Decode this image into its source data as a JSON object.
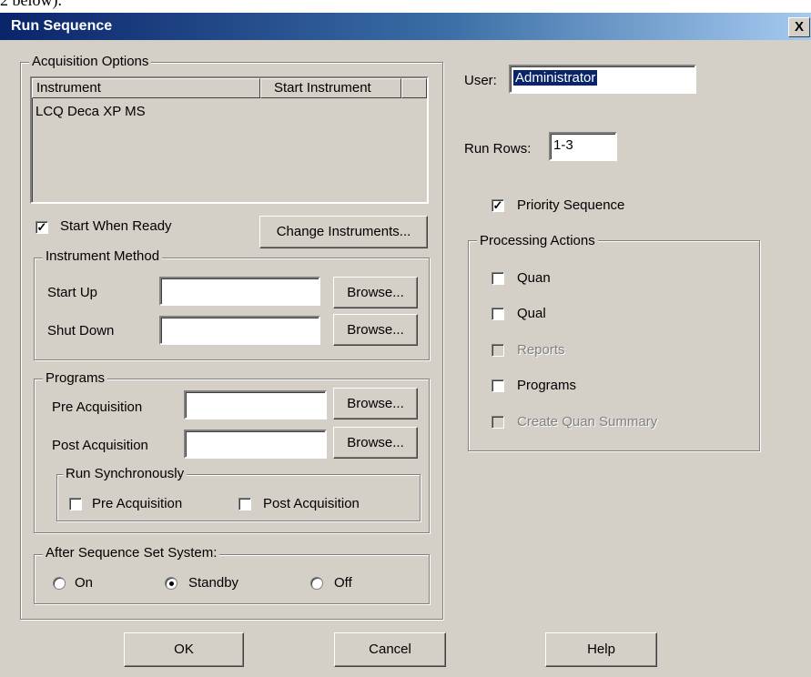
{
  "page_fragment": "2 below).",
  "window": {
    "title": "Run Sequence",
    "close_label": "X"
  },
  "acquisition": {
    "legend": "Acquisition Options",
    "columns": [
      "Instrument",
      "Start Instrument"
    ],
    "rows": [
      {
        "instrument": "LCQ Deca XP MS",
        "start_instrument": ""
      }
    ],
    "start_when_ready": {
      "label": "Start When Ready",
      "checked": true
    },
    "change_instruments_label": "Change Instruments..."
  },
  "instrument_method": {
    "legend": "Instrument Method",
    "start_up": {
      "label": "Start Up",
      "value": "",
      "browse": "Browse..."
    },
    "shut_down": {
      "label": "Shut Down",
      "value": "",
      "browse": "Browse..."
    }
  },
  "programs": {
    "legend": "Programs",
    "pre_acquisition": {
      "label": "Pre Acquisition",
      "value": "",
      "browse": "Browse..."
    },
    "post_acquisition": {
      "label": "Post Acquisition",
      "value": "",
      "browse": "Browse..."
    },
    "run_synchronously": {
      "legend": "Run Synchronously",
      "pre": {
        "label": "Pre Acquisition",
        "checked": false
      },
      "post": {
        "label": "Post Acquisition",
        "checked": false
      }
    }
  },
  "after_sequence": {
    "legend": "After Sequence Set System:",
    "options": [
      "On",
      "Standby",
      "Off"
    ],
    "selected": "Standby"
  },
  "user": {
    "label": "User:",
    "value": "Administrator"
  },
  "run_rows": {
    "label": "Run Rows:",
    "value": "1-3"
  },
  "priority_sequence": {
    "label": "Priority Sequence",
    "checked": true
  },
  "processing": {
    "legend": "Processing Actions",
    "items": [
      {
        "label": "Quan",
        "checked": false,
        "enabled": true
      },
      {
        "label": "Qual",
        "checked": false,
        "enabled": true
      },
      {
        "label": "Reports",
        "checked": false,
        "enabled": false
      },
      {
        "label": "Programs",
        "checked": false,
        "enabled": true
      },
      {
        "label": "Create Quan Summary",
        "checked": false,
        "enabled": false
      }
    ]
  },
  "buttons": {
    "ok": "OK",
    "cancel": "Cancel",
    "help": "Help"
  }
}
